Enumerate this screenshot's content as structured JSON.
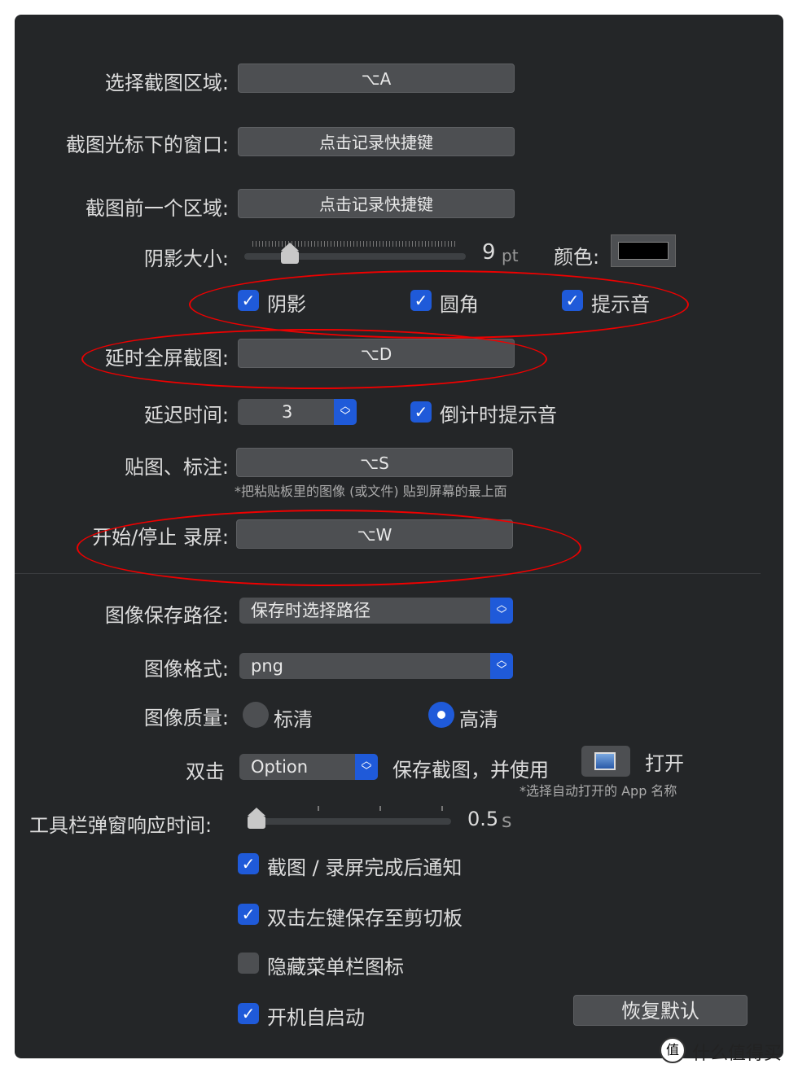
{
  "shortcuts": {
    "select_area": {
      "label": "选择截图区域:",
      "value": "⌥A"
    },
    "window_under_cursor": {
      "label": "截图光标下的窗口:",
      "value": "点击记录快捷键"
    },
    "previous_area": {
      "label": "截图前一个区域:",
      "value": "点击记录快捷键"
    },
    "delayed_fullscreen": {
      "label": "延时全屏截图:",
      "value": "⌥D"
    },
    "pin_annotate": {
      "label": "贴图、标注:",
      "value": "⌥S",
      "note": "*把粘贴板里的图像 (或文件) 贴到屏幕的最上面"
    },
    "record": {
      "label": "开始/停止 录屏:",
      "value": "⌥W"
    }
  },
  "shadow": {
    "label": "阴影大小:",
    "value": "9",
    "unit": "pt",
    "level_percent": 20,
    "color_label": "颜色:",
    "color": "#000000"
  },
  "options": {
    "shadow": {
      "label": "阴影",
      "checked": true
    },
    "rounded": {
      "label": "圆角",
      "checked": true
    },
    "sound": {
      "label": "提示音",
      "checked": true
    }
  },
  "delay": {
    "label": "延迟时间:",
    "value": "3",
    "countdown": {
      "label": "倒计时提示音",
      "checked": true
    }
  },
  "save_path": {
    "label": "图像保存路径:",
    "value": "保存时选择路径"
  },
  "format": {
    "label": "图像格式:",
    "value": "png"
  },
  "quality": {
    "label": "图像质量:",
    "standard": "标清",
    "high": "高清",
    "selected": "高清"
  },
  "double_click": {
    "label": "双击",
    "modifier": "Option",
    "action": "保存截图，并使用",
    "open": "打开",
    "note": "*选择自动打开的 App 名称"
  },
  "toolbar_delay": {
    "label": "工具栏弹窗响应时间:",
    "value": "0.5",
    "unit": "s"
  },
  "checks": [
    {
      "label": "截图 / 录屏完成后通知",
      "checked": true
    },
    {
      "label": "双击左键保存至剪切板",
      "checked": true
    },
    {
      "label": "隐藏菜单栏图标",
      "checked": false
    },
    {
      "label": "开机自启动",
      "checked": true
    }
  ],
  "restore_defaults": "恢复默认",
  "watermark": "什么值得买",
  "colors": {
    "accent": "#1f5ad9",
    "background": "#242628",
    "annotation": "#e00000"
  }
}
